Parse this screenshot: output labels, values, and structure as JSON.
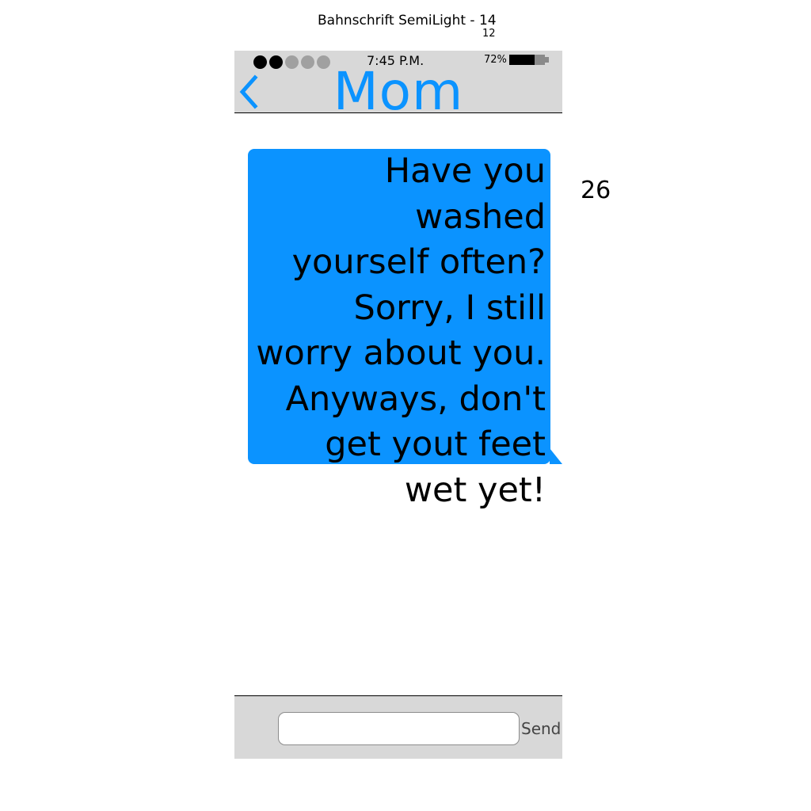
{
  "annotations": {
    "font_label": "Bahnschrift SemiLight - 14",
    "small_size": "12",
    "side_size": "26"
  },
  "status_bar": {
    "signal_total": 5,
    "signal_filled": 2,
    "time": "7:45 P.M.",
    "battery_percent_label": "72%",
    "battery_level": 0.72
  },
  "header": {
    "contact_name": "Mom",
    "back_icon": "chevron-left-icon"
  },
  "messages": [
    {
      "text": "Have you washed\nyourself often?\nSorry, I still\nworry about you.\nAnyways, don't\nget yout feet\nwet yet!"
    }
  ],
  "composer": {
    "input_value": "",
    "input_placeholder": "",
    "send_label": "Send"
  },
  "colors": {
    "accent": "#0b93ff",
    "bar_background": "#d8d8d8",
    "signal_on": "#000000",
    "signal_off": "#a0a0a0"
  }
}
